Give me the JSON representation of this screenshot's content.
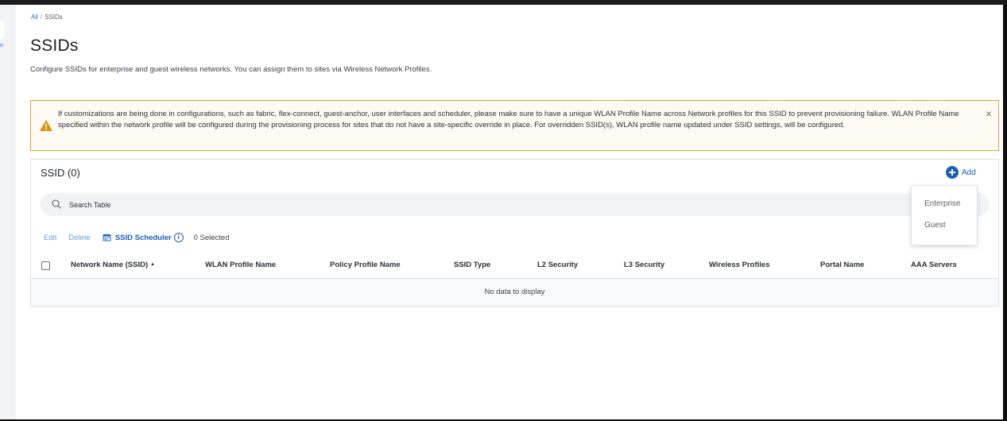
{
  "breadcrumb": {
    "root": "All",
    "separator": "/",
    "current": "SSIDs"
  },
  "page": {
    "title": "SSIDs",
    "description": "Configure SSIDs for enterprise and guest wireless networks. You can assign them to sites via Wireless Network Profiles."
  },
  "alert": {
    "icon": "warning-triangle-icon",
    "color": "#e6a42e",
    "text": "If customizations are being done in configurations, such as fabric, flex-connect, guest-anchor, user interfaces and scheduler, please make sure to have a unique WLAN Profile Name across Network profiles for this SSID to prevent provisioning failure. WLAN Profile Name specified within the network profile will be configured during the provisioning process for sites that do not have a site-specific override in place. For overridden SSID(s), WLAN profile name updated under SSID settings, will be configured.",
    "close": "×"
  },
  "panel": {
    "title": "SSID (0)",
    "add_label": "Add",
    "search_placeholder": "Search Table",
    "actions": {
      "edit": "Edit",
      "delete": "Delete",
      "scheduler": "SSID Scheduler",
      "info": "i",
      "selected": "0 Selected"
    },
    "columns": [
      "Network Name (SSID)",
      "WLAN Profile Name",
      "Policy Profile Name",
      "SSID Type",
      "L2 Security",
      "L3 Security",
      "Wireless Profiles",
      "Portal Name",
      "AAA Servers"
    ],
    "sort_indicator": "▲",
    "empty_message": "No data to display"
  },
  "add_menu": {
    "items": [
      "Enterprise",
      "Guest"
    ]
  },
  "colors": {
    "accent": "#1b5fb3",
    "link": "#1a73c8",
    "warning": "#e6a42e"
  }
}
